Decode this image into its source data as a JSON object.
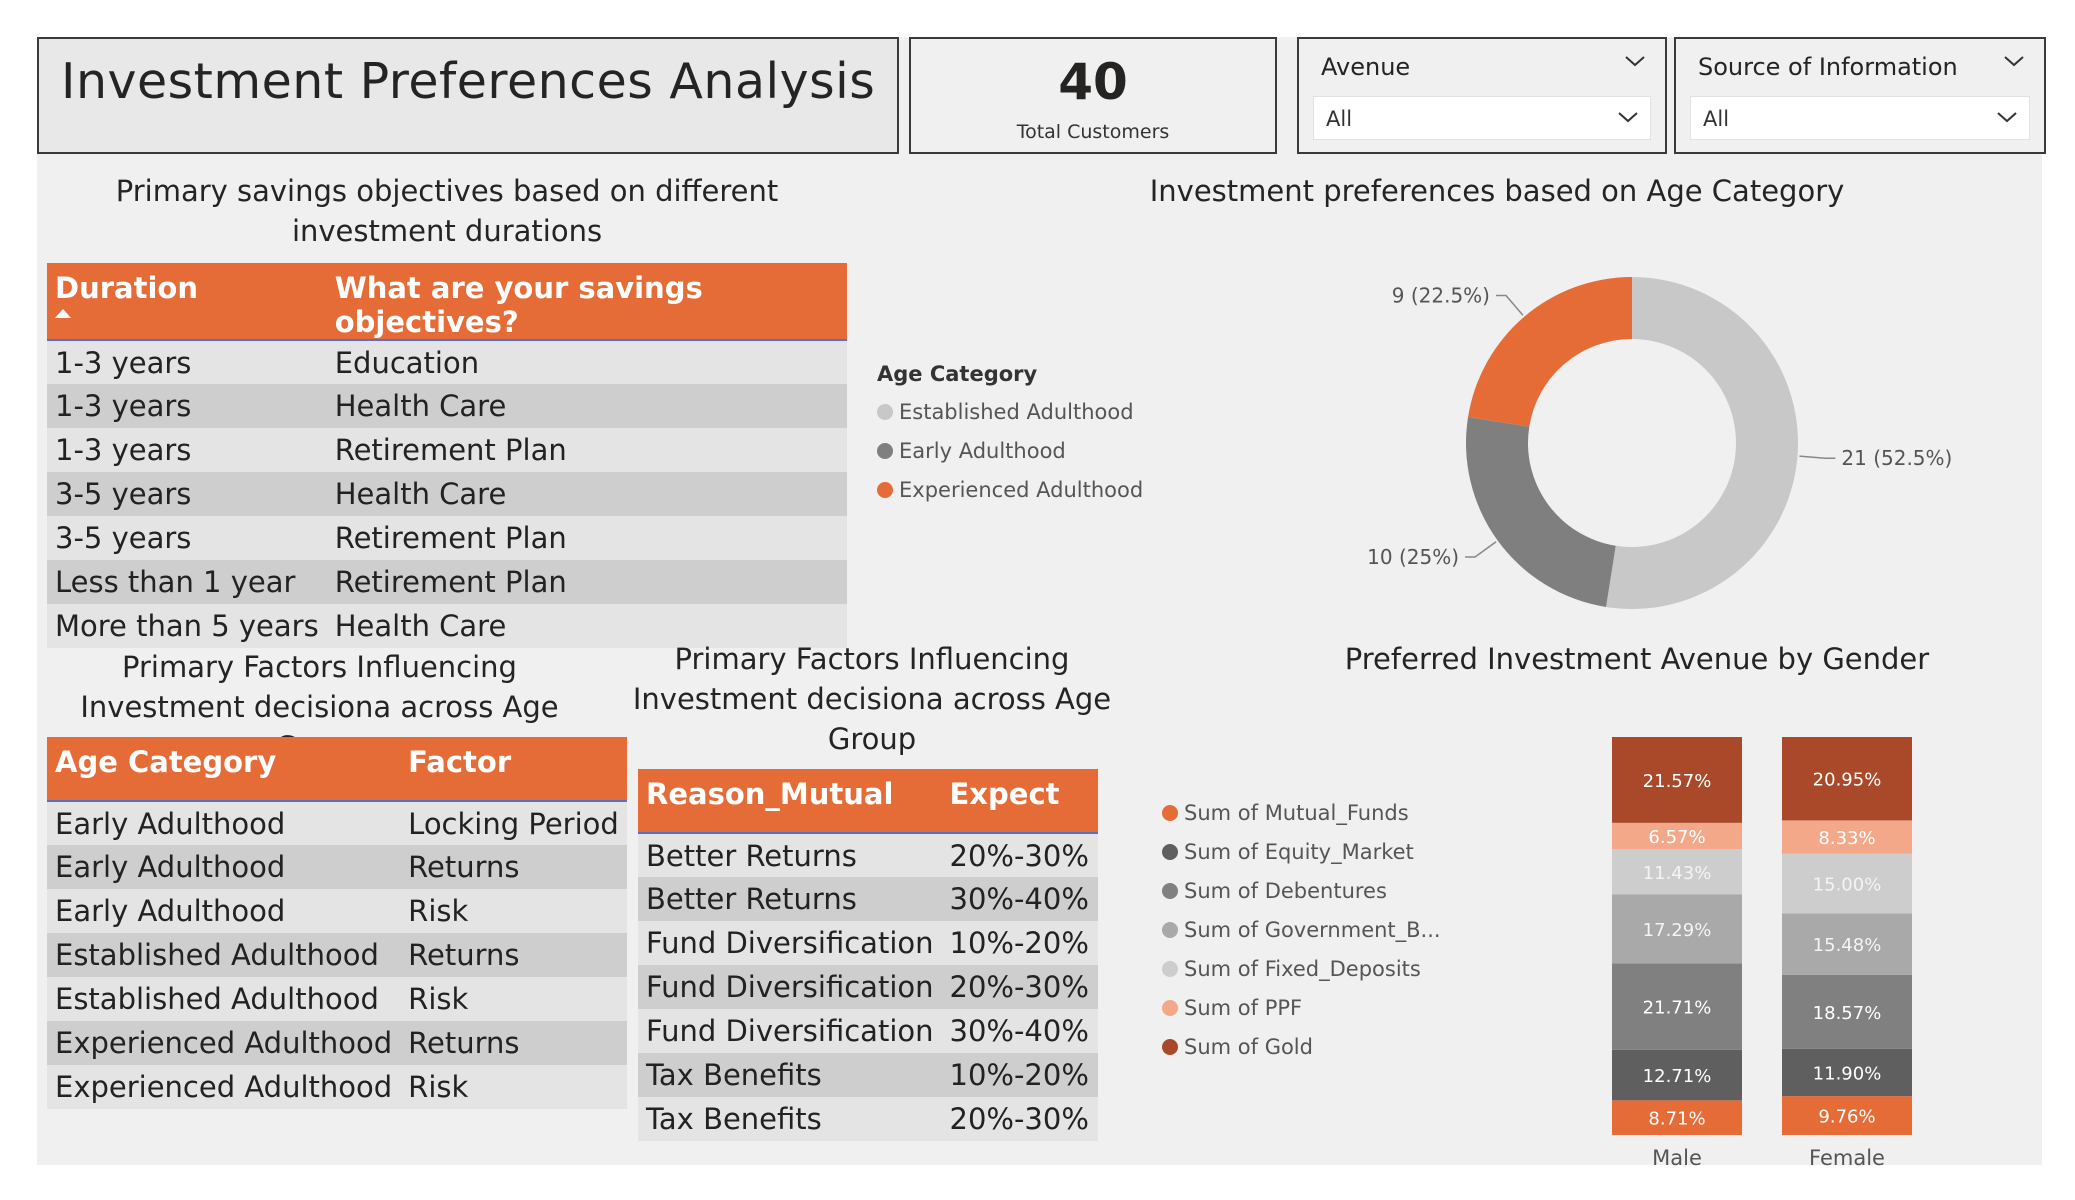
{
  "header": {
    "title": "Investment Preferences Analysis",
    "kpi": {
      "value": "40",
      "label": "Total Customers"
    }
  },
  "slicers": [
    {
      "label": "Avenue",
      "value": "All"
    },
    {
      "label": "Source of Information",
      "value": "All"
    }
  ],
  "savings_table": {
    "title": "Primary savings objectives based on different investment durations",
    "columns": [
      "Duration",
      "What are your savings objectives?"
    ],
    "sorted_column": "Duration",
    "rows": [
      [
        "1-3 years",
        "Education"
      ],
      [
        "1-3 years",
        "Health Care"
      ],
      [
        "1-3 years",
        "Retirement Plan"
      ],
      [
        "3-5 years",
        "Health Care"
      ],
      [
        "3-5 years",
        "Retirement Plan"
      ],
      [
        "Less than 1 year",
        "Retirement Plan"
      ],
      [
        "More than 5 years",
        "Health Care"
      ]
    ]
  },
  "factors_table": {
    "title": "Primary Factors Influencing Investment decisiona across Age Group",
    "columns": [
      "Age Category",
      "Factor"
    ],
    "rows": [
      [
        "Early Adulthood",
        "Locking Period"
      ],
      [
        "Early Adulthood",
        "Returns"
      ],
      [
        "Early Adulthood",
        "Risk"
      ],
      [
        "Established Adulthood",
        "Returns"
      ],
      [
        "Established Adulthood",
        "Risk"
      ],
      [
        "Experienced Adulthood",
        "Returns"
      ],
      [
        "Experienced Adulthood",
        "Risk"
      ]
    ]
  },
  "mutual_table": {
    "title": "Primary Factors Influencing Investment decisiona across Age Group",
    "columns": [
      "Reason_Mutual",
      "Expect"
    ],
    "rows": [
      [
        "Better Returns",
        "20%-30%"
      ],
      [
        "Better Returns",
        "30%-40%"
      ],
      [
        "Fund Diversification",
        "10%-20%"
      ],
      [
        "Fund Diversification",
        "20%-30%"
      ],
      [
        "Fund Diversification",
        "30%-40%"
      ],
      [
        "Tax Benefits",
        "10%-20%"
      ],
      [
        "Tax Benefits",
        "20%-30%"
      ]
    ]
  },
  "colors": {
    "accent": "#e66c37",
    "header_rule": "#5b6fbf",
    "row_light": "#e4e4e4",
    "row_dark": "#cecece"
  },
  "chart_data": [
    {
      "type": "pie",
      "donut": true,
      "title": "Investment preferences based on Age Category",
      "legend_title": "Age Category",
      "legend_position": "left",
      "slices": [
        {
          "name": "Established Adulthood",
          "value": 21,
          "label": "21 (52.5%)",
          "color": "#c8c8c8"
        },
        {
          "name": "Early Adulthood",
          "value": 10,
          "label": "10 (25%)",
          "color": "#7f7f7f"
        },
        {
          "name": "Experienced Adulthood",
          "value": 9,
          "label": "9 (22.5%)",
          "color": "#e66c37"
        }
      ]
    },
    {
      "type": "bar",
      "stacked": "100%",
      "title": "Preferred Investment Avenue by Gender",
      "legend_position": "left",
      "categories": [
        "Male",
        "Female"
      ],
      "series": [
        {
          "name": "Sum of Mutual_Funds",
          "values": [
            8.71,
            9.76
          ],
          "labels": [
            "8.71%",
            "9.76%"
          ],
          "color": "#e66c37"
        },
        {
          "name": "Sum of Equity_Market",
          "values": [
            12.71,
            11.9
          ],
          "labels": [
            "12.71%",
            "11.90%"
          ],
          "color": "#5f5f5f"
        },
        {
          "name": "Sum of Debentures",
          "values": [
            21.71,
            18.57
          ],
          "labels": [
            "21.71%",
            "18.57%"
          ],
          "color": "#808080"
        },
        {
          "name": "Sum of Government_B...",
          "values": [
            17.29,
            15.48
          ],
          "labels": [
            "17.29%",
            "15.48%"
          ],
          "color": "#a9a9a9"
        },
        {
          "name": "Sum of Fixed_Deposits",
          "values": [
            11.43,
            15.0
          ],
          "labels": [
            "11.43%",
            "15.00%"
          ],
          "color": "#cdcdcd"
        },
        {
          "name": "Sum of PPF",
          "values": [
            6.57,
            8.33
          ],
          "labels": [
            "6.57%",
            "8.33%"
          ],
          "color": "#f3a889"
        },
        {
          "name": "Sum of Gold",
          "values": [
            21.57,
            20.95
          ],
          "labels": [
            "21.57%",
            "20.95%"
          ],
          "color": "#a9492a"
        }
      ]
    }
  ]
}
